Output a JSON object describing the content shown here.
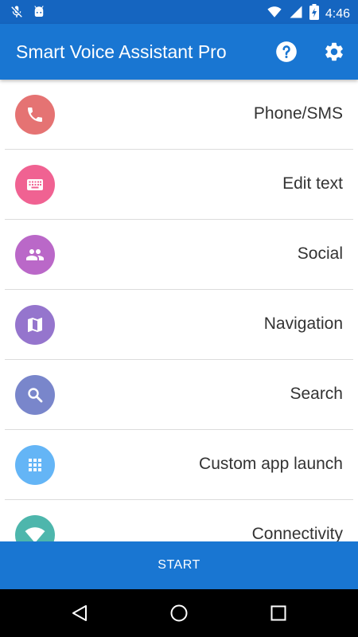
{
  "status_bar": {
    "time": "4:46",
    "icons": [
      "mic-off-icon",
      "android-icon",
      "wifi-icon",
      "signal-icon",
      "battery-charging-icon"
    ]
  },
  "app_bar": {
    "title": "Smart Voice Assistant Pro",
    "actions": [
      "help-icon",
      "settings-icon"
    ]
  },
  "list": {
    "items": [
      {
        "label": "Phone/SMS",
        "icon": "phone-icon",
        "color": "#e57373"
      },
      {
        "label": "Edit text",
        "icon": "keyboard-icon",
        "color": "#f06292"
      },
      {
        "label": "Social",
        "icon": "people-icon",
        "color": "#ba68c8"
      },
      {
        "label": "Navigation",
        "icon": "map-icon",
        "color": "#9575cd"
      },
      {
        "label": "Search",
        "icon": "search-icon",
        "color": "#7986cb"
      },
      {
        "label": "Custom app launch",
        "icon": "apps-grid-icon",
        "color": "#64b5f6"
      },
      {
        "label": "Connectivity",
        "icon": "wifi-icon",
        "color": "#4db6ac"
      }
    ]
  },
  "start_button": {
    "label": "START"
  },
  "nav_bar": {
    "icons": [
      "back-icon",
      "home-icon",
      "recent-apps-icon"
    ]
  },
  "colors": {
    "primary": "#1976d2",
    "status_bar": "#1565c0"
  }
}
